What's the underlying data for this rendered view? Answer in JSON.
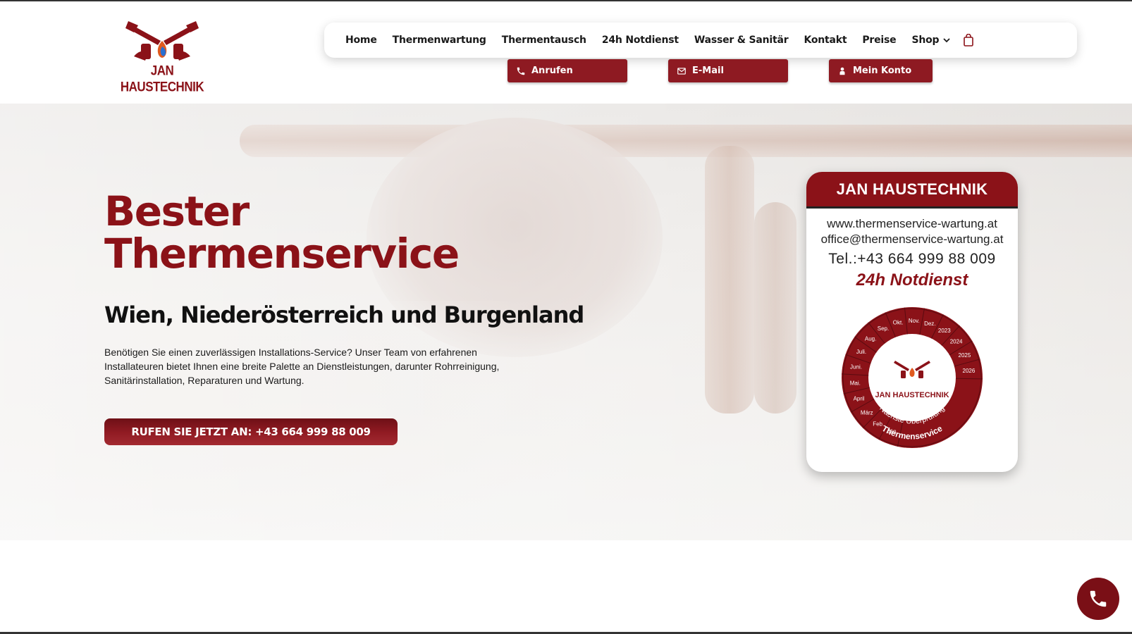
{
  "brand": {
    "logo_text": "JAN HAUSTECHNIK",
    "accent": "#8b1218"
  },
  "nav": {
    "items": [
      {
        "label": "Home"
      },
      {
        "label": "Thermenwartung"
      },
      {
        "label": "Thermentausch"
      },
      {
        "label": "24h Notdienst"
      },
      {
        "label": "Wasser & Sanitär"
      },
      {
        "label": "Kontakt"
      },
      {
        "label": "Preise"
      }
    ],
    "shop_label": "Shop",
    "cart_icon": "shopping-bag-icon"
  },
  "quick_actions": {
    "call": {
      "label": "Anrufen",
      "icon": "phone-icon"
    },
    "email": {
      "label": "E-Mail",
      "icon": "envelope-icon"
    },
    "account": {
      "label": "Mein Konto",
      "icon": "user-icon"
    }
  },
  "hero": {
    "title_line1": "Bester",
    "title_line2": "Thermenservice",
    "subtitle": "Wien, Niederösterreich und Burgenland",
    "paragraph": "Benötigen Sie einen zuverlässigen Installations-Service? Unser Team von erfahrenen Installateuren bietet Ihnen eine breite Palette an Dienstleistungen, darunter Rohrreinigung, Sanitärinstallation, Reparaturen und Wartung.",
    "call_button": "RUFEN SIE JETZT AN: +43 664 999 88 009"
  },
  "card": {
    "header": "JAN HAUSTECHNIK",
    "website": "www.thermenservice-wartung.at",
    "email": "office@thermenservice-wartung.at",
    "phone": "Tel.:+43 664 999 88 009",
    "emergency": "24h Notdienst",
    "dial": {
      "months": [
        "Jän.",
        "Feb.",
        "März",
        "April",
        "Mai.",
        "Juni.",
        "Juli.",
        "Aug.",
        "Sep.",
        "Okt.",
        "Nov.",
        "Dez."
      ],
      "years": [
        "2023",
        "2024",
        "2025",
        "2026"
      ],
      "logo_text": "JAN HAUSTECHNIK",
      "ring_text_top": "Nächste Überprüfung",
      "ring_text_bottom": "Thermenservice"
    }
  },
  "floating": {
    "icon": "phone-icon"
  }
}
